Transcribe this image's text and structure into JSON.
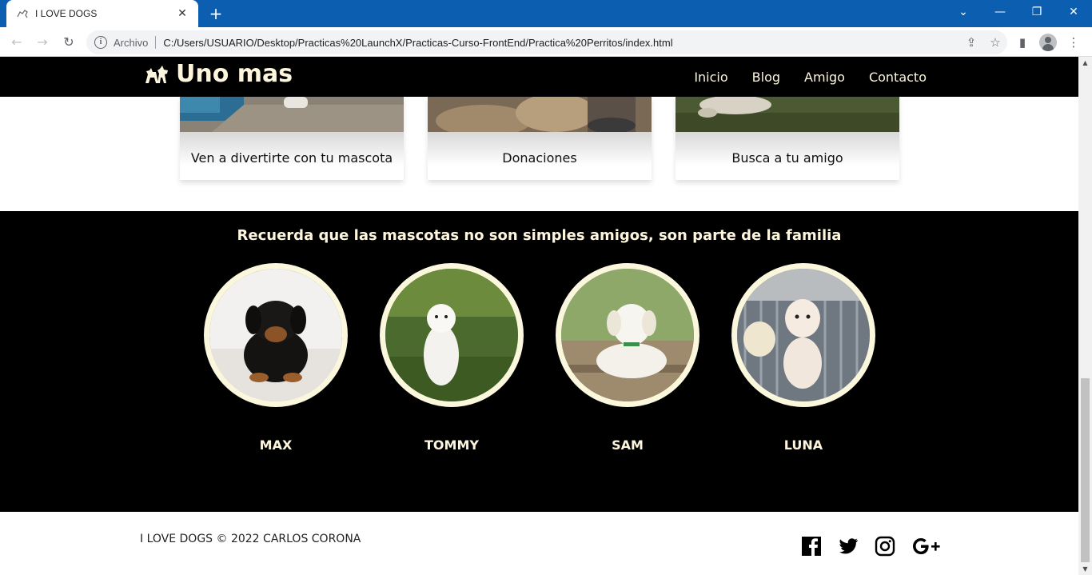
{
  "browser": {
    "tab_title": "I LOVE DOGS",
    "new_tab": "+",
    "omnibox_chip": "Archivo",
    "url": "C:/Users/USUARIO/Desktop/Practicas%20LaunchX/Practicas-Curso-FrontEnd/Practica%20Perritos/index.html",
    "accent": "#0b5eb0"
  },
  "site": {
    "brand": "Uno mas",
    "nav": [
      "Inicio",
      "Blog",
      "Amigo",
      "Contacto"
    ]
  },
  "cards": [
    {
      "caption": "Ven a divertirte con tu mascota"
    },
    {
      "caption": "Donaciones"
    },
    {
      "caption": "Busca a tu amigo"
    }
  ],
  "pets": {
    "title": "Recuerda que las mascotas no son simples amigos, son parte de la familia",
    "items": [
      {
        "name": "MAX"
      },
      {
        "name": "TOMMY"
      },
      {
        "name": "SAM"
      },
      {
        "name": "LUNA"
      }
    ]
  },
  "footer": {
    "copyright": "I LOVE DOGS © 2022 CARLOS CORONA",
    "social": [
      "facebook-icon",
      "twitter-icon",
      "instagram-icon",
      "google-plus-icon"
    ]
  },
  "colors": {
    "cream": "#fdf5dc",
    "black": "#000000"
  }
}
